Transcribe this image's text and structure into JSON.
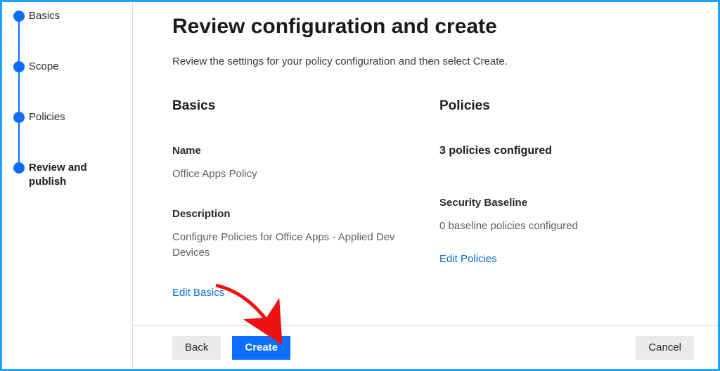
{
  "nav": {
    "steps": [
      {
        "label": "Basics"
      },
      {
        "label": "Scope"
      },
      {
        "label": "Policies"
      },
      {
        "label": "Review and publish"
      }
    ]
  },
  "page": {
    "title": "Review configuration and create",
    "subtitle": "Review the settings for your policy configuration and then select Create."
  },
  "basics": {
    "heading": "Basics",
    "name_label": "Name",
    "name_value": "Office Apps Policy",
    "description_label": "Description",
    "description_value": "Configure Policies for Office Apps - Applied Dev Devices",
    "edit_link": "Edit Basics"
  },
  "policies": {
    "heading": "Policies",
    "summary": "3 policies configured",
    "baseline_label": "Security Baseline",
    "baseline_value": "0 baseline policies configured",
    "edit_link": "Edit Policies"
  },
  "footer": {
    "back": "Back",
    "create": "Create",
    "cancel": "Cancel"
  }
}
